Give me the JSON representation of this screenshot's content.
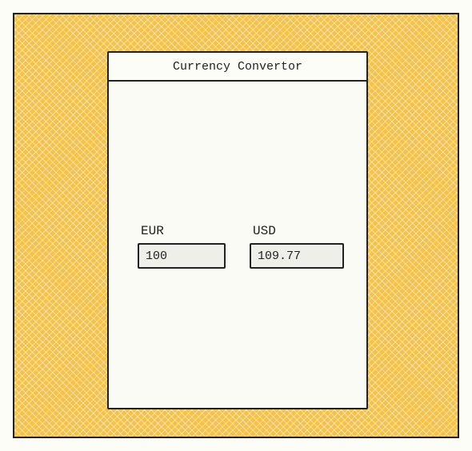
{
  "window": {
    "title": "Currency Convertor"
  },
  "converter": {
    "from": {
      "label": "EUR",
      "value": "100"
    },
    "to": {
      "label": "USD",
      "value": "109.77"
    }
  }
}
